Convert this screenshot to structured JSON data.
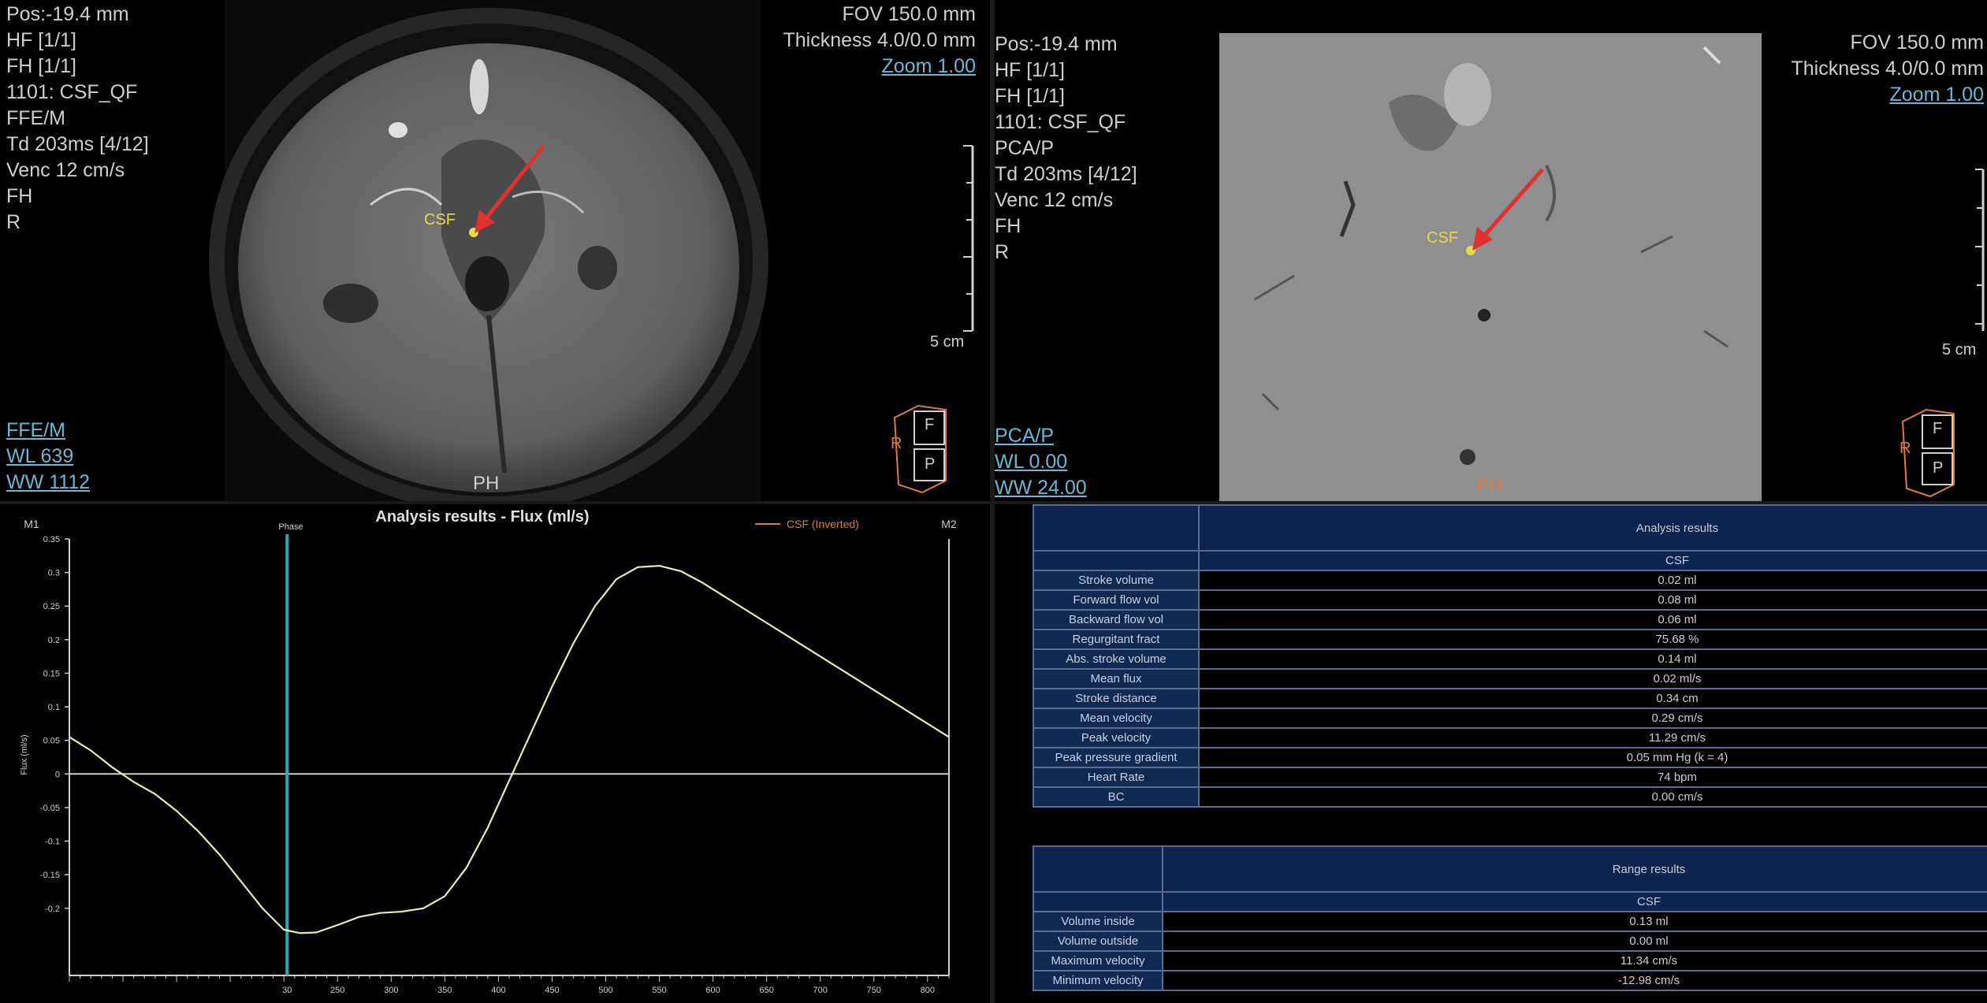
{
  "left_view": {
    "info": [
      "Pos:-19.4 mm",
      "HF [1/1]",
      "FH [1/1]",
      "1101: CSF_QF",
      "FFE/M",
      "Td 203ms [4/12]",
      "Venc 12 cm/s",
      "FH",
      "R"
    ],
    "fov": "FOV 150.0 mm",
    "thickness": "Thickness 4.0/0.0 mm",
    "zoom": "Zoom 1.00",
    "roi_label": "CSF",
    "scale_label": "5 cm",
    "orient_f": "F",
    "orient_p": "P",
    "orient_r": "R",
    "bottom_label": "PH",
    "series": "FFE/M",
    "wl": "WL   639",
    "ww": "WW  1112"
  },
  "right_view": {
    "info": [
      "Pos:-19.4 mm",
      "HF [1/1]",
      "FH [1/1]",
      "1101: CSF_QF",
      "PCA/P",
      "Td 203ms [4/12]",
      "Venc 12 cm/s",
      "FH",
      "R"
    ],
    "fov": "FOV 150.0 mm",
    "thickness": "Thickness 4.0/0.0 mm",
    "zoom": "Zoom 1.00",
    "roi_label": "CSF",
    "scale_label": "5 cm",
    "orient_f": "F",
    "orient_p": "P",
    "orient_r": "R",
    "bottom_label": "PH",
    "series": "PCA/P",
    "wl": "WL   0.00",
    "ww": "WW 24.00"
  },
  "chart": {
    "title": "Analysis results - Flux (ml/s)",
    "legend_label": "CSF  (Inverted)",
    "marker_left": "M1",
    "marker_right": "M2",
    "phase_label": "Phase",
    "ylabel": "Flux (ml/s)",
    "colors": {
      "curve": "#e6ecb8",
      "phase": "#2fa7b8",
      "legend_text": "#e07b3c",
      "axis": "#d0d0d0"
    }
  },
  "chart_data": {
    "type": "line",
    "title": "Analysis results - Flux (ml/s)",
    "xlabel": "",
    "ylabel": "Flux (ml/s)",
    "xlim": [
      0,
      820
    ],
    "ylim": [
      -0.3,
      0.35
    ],
    "yticks": [
      "0.35",
      "0.3",
      "0.25",
      "0.2",
      "0.15",
      "0.1",
      "0.05",
      "0",
      "-0.05",
      "-0.1",
      "-0.15",
      "-0.2"
    ],
    "ytick_values": [
      0.35,
      0.3,
      0.25,
      0.2,
      0.15,
      0.1,
      0.05,
      0,
      -0.05,
      -0.1,
      -0.15,
      -0.2
    ],
    "xticks": [
      "30",
      "250",
      "300",
      "350",
      "400",
      "450",
      "500",
      "550",
      "600",
      "650",
      "700",
      "750",
      "800"
    ],
    "xtick_values": [
      203,
      250,
      300,
      350,
      400,
      450,
      500,
      550,
      600,
      650,
      700,
      750,
      800
    ],
    "phase_x": 203,
    "grid": false,
    "legend_position": "top-right",
    "series": [
      {
        "name": "CSF  (Inverted)",
        "x": [
          0,
          20,
          40,
          60,
          80,
          100,
          120,
          140,
          160,
          180,
          200,
          215,
          230,
          250,
          270,
          290,
          310,
          330,
          350,
          370,
          390,
          410,
          430,
          450,
          470,
          490,
          510,
          530,
          550,
          570,
          590,
          610,
          630,
          650,
          670,
          690,
          710,
          730,
          750,
          770,
          790,
          810,
          820
        ],
        "y": [
          0.055,
          0.035,
          0.01,
          -0.012,
          -0.03,
          -0.055,
          -0.085,
          -0.12,
          -0.16,
          -0.2,
          -0.232,
          -0.237,
          -0.236,
          -0.225,
          -0.213,
          -0.207,
          -0.205,
          -0.2,
          -0.182,
          -0.14,
          -0.08,
          -0.01,
          0.06,
          0.13,
          0.195,
          0.25,
          0.29,
          0.308,
          0.31,
          0.302,
          0.285,
          0.265,
          0.245,
          0.225,
          0.205,
          0.185,
          0.165,
          0.145,
          0.125,
          0.105,
          0.085,
          0.065,
          0.055
        ]
      }
    ]
  },
  "analysis_table": {
    "header": "Analysis results",
    "column": "CSF",
    "rows": [
      {
        "label": "Stroke volume",
        "value": "0.02 ml"
      },
      {
        "label": "Forward flow vol",
        "value": "0.08 ml"
      },
      {
        "label": "Backward flow vol",
        "value": "0.06 ml"
      },
      {
        "label": "Regurgitant fract",
        "value": "75.68 %"
      },
      {
        "label": "Abs. stroke volume",
        "value": "0.14 ml"
      },
      {
        "label": "Mean flux",
        "value": "0.02 ml/s"
      },
      {
        "label": "Stroke distance",
        "value": "0.34 cm"
      },
      {
        "label": "Mean velocity",
        "value": "0.29 cm/s"
      },
      {
        "label": "Peak velocity",
        "value": "11.29 cm/s"
      },
      {
        "label": "Peak pressure gradient",
        "value": "0.05 mm Hg (k = 4)"
      },
      {
        "label": "Heart Rate",
        "value": "74 bpm"
      },
      {
        "label": "BC",
        "value": "0.00 cm/s"
      }
    ]
  },
  "range_table": {
    "header": "Range results",
    "column": "CSF",
    "rows": [
      {
        "label": "Volume inside",
        "value": "0.13 ml"
      },
      {
        "label": "Volume outside",
        "value": "0.00 ml"
      },
      {
        "label": "Maximum velocity",
        "value": "11.34 cm/s"
      },
      {
        "label": "Minimum velocity",
        "value": "-12.98 cm/s"
      }
    ]
  }
}
